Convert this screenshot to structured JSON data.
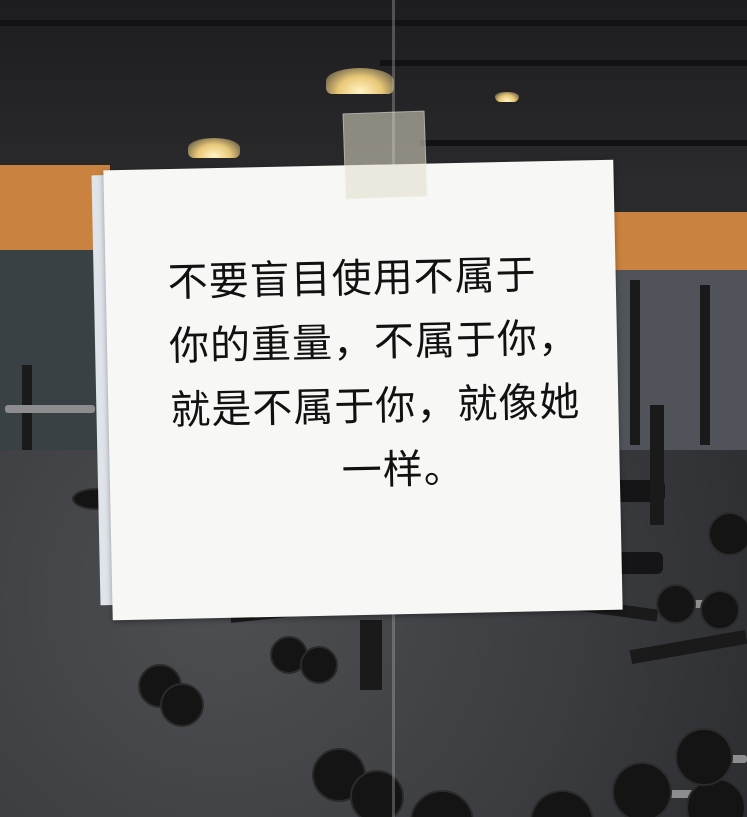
{
  "sign": {
    "lines": [
      "不要盲目使用不属于",
      "你的重量，不属于你，",
      "就是不属于你，就像她",
      "一样。"
    ]
  }
}
